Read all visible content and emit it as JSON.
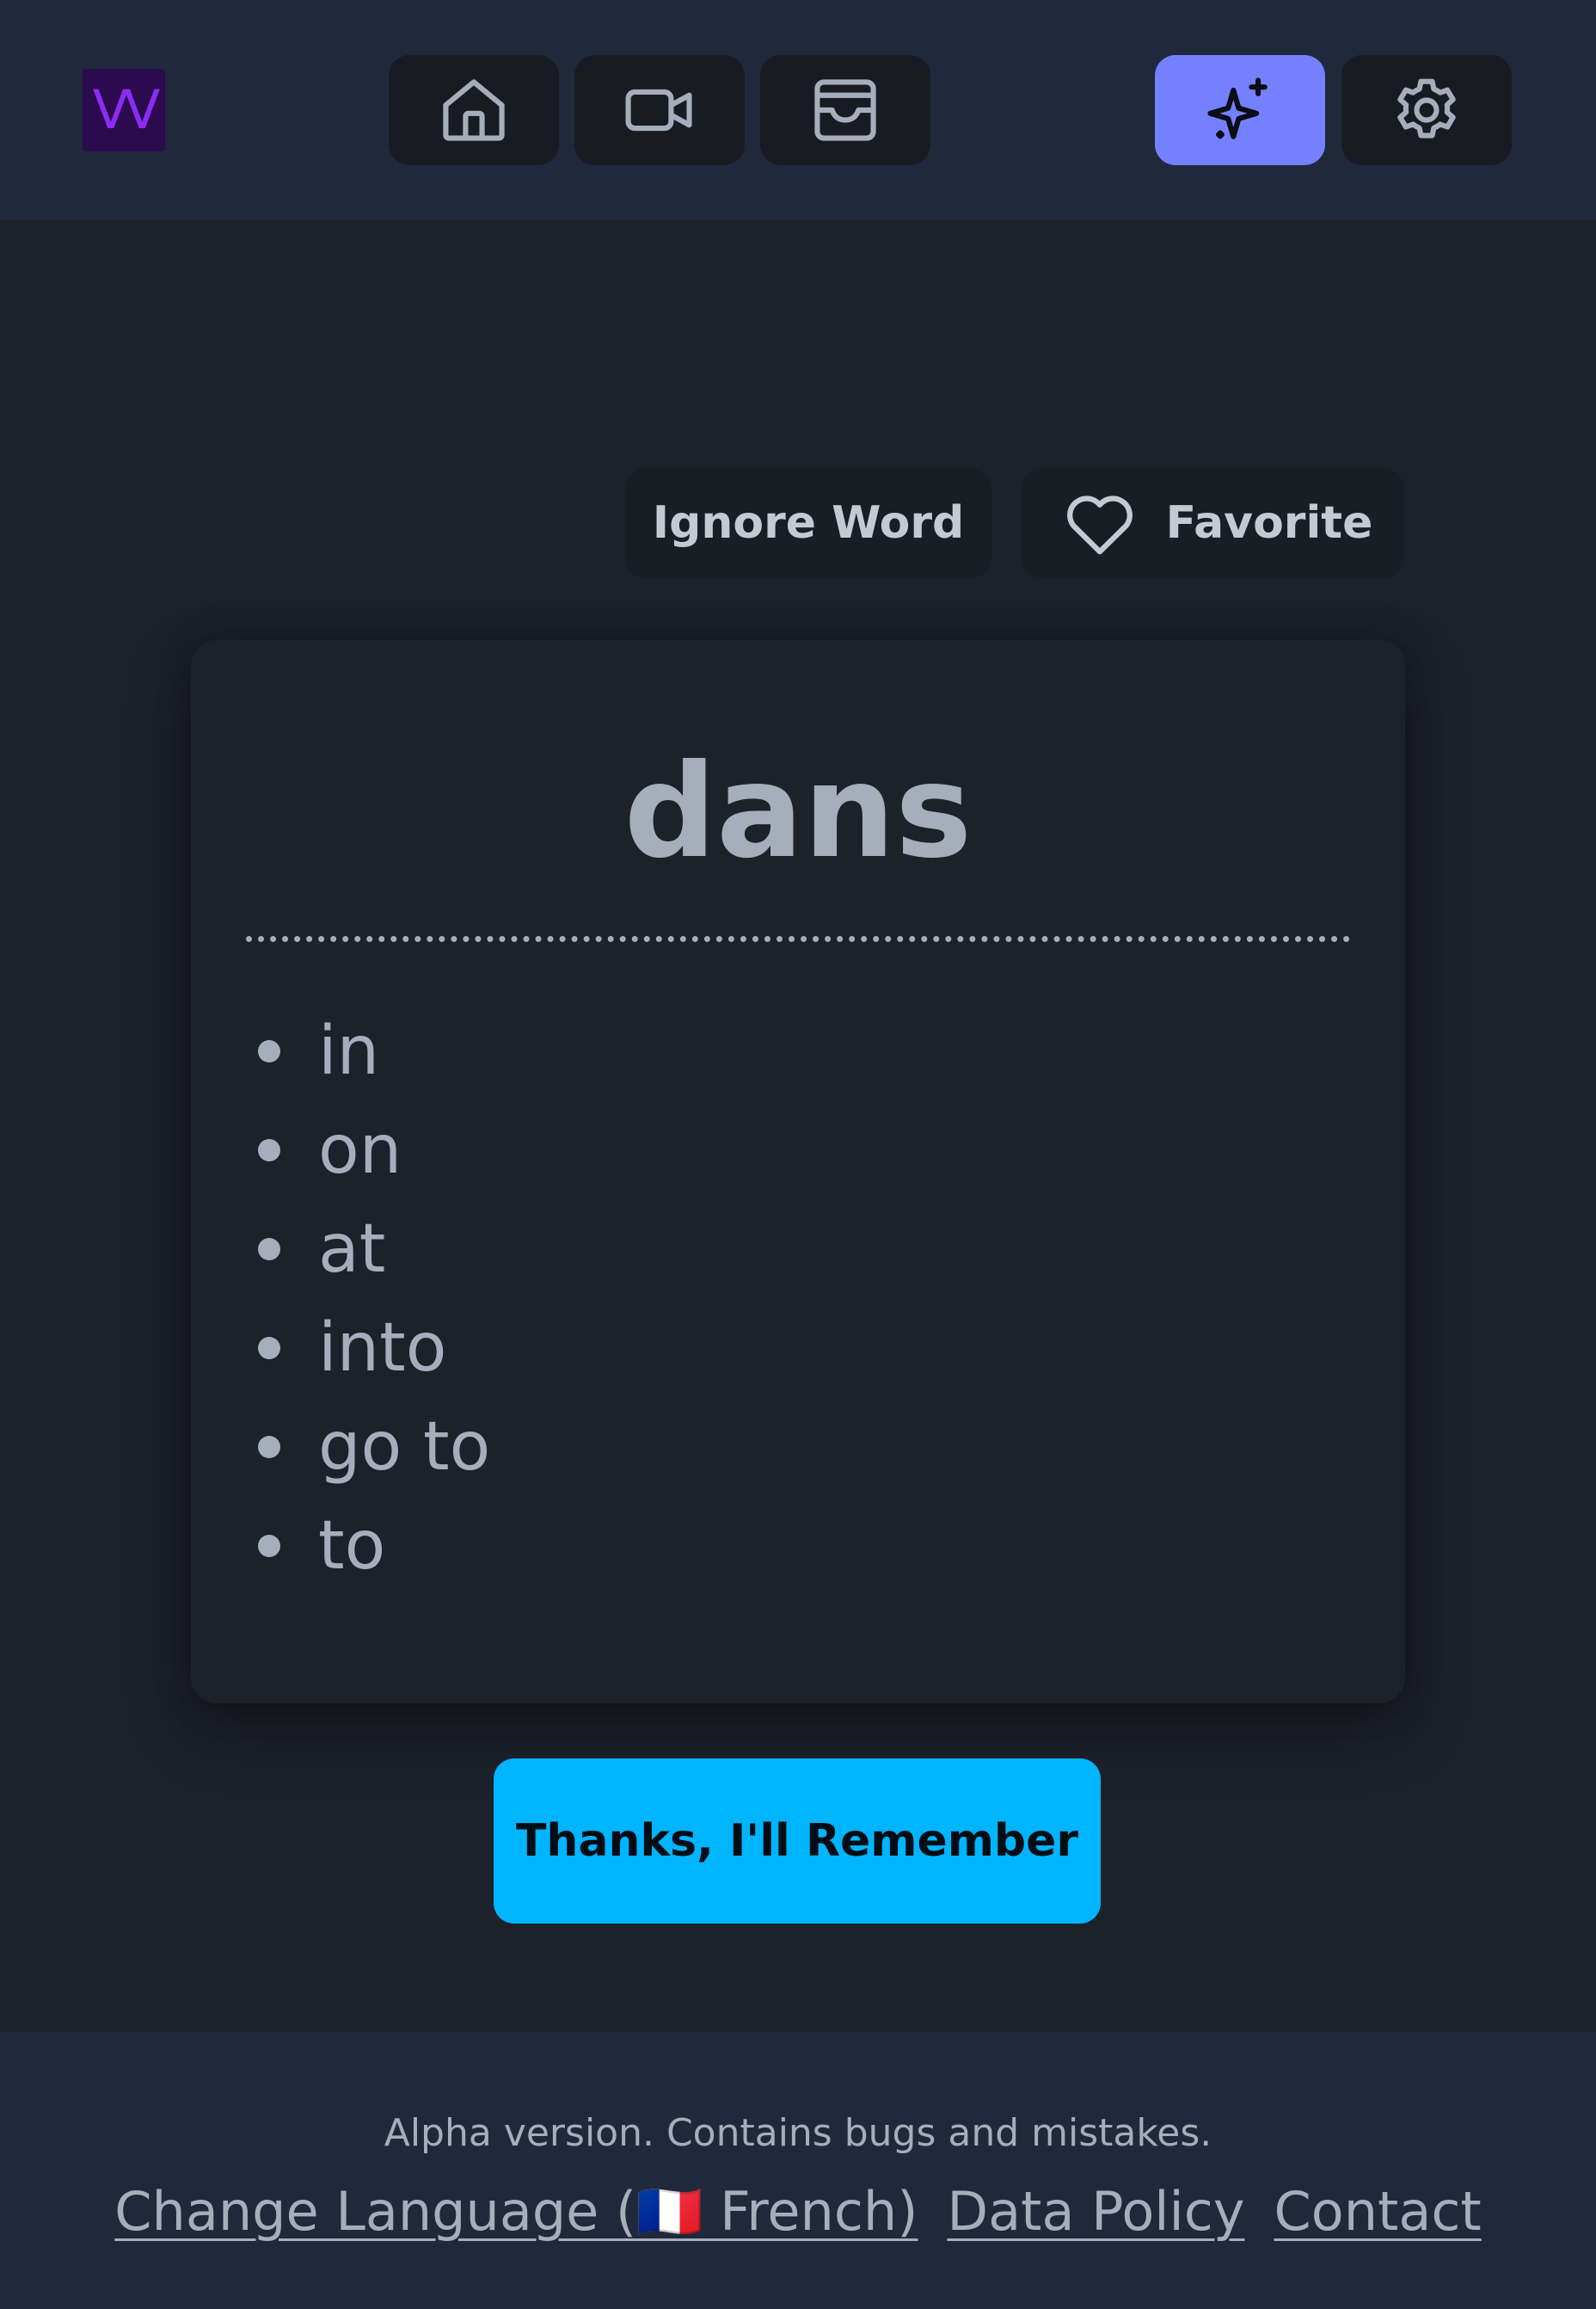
{
  "header": {
    "logo_text": "VV",
    "nav": [
      {
        "name": "home",
        "icon": "home-icon"
      },
      {
        "name": "video",
        "icon": "video-camera-icon"
      },
      {
        "name": "inbox",
        "icon": "inbox-icon"
      },
      {
        "name": "sparkle",
        "icon": "sparkles-icon",
        "active": true
      },
      {
        "name": "settings",
        "icon": "gear-icon"
      }
    ],
    "active_color": "#7480ff"
  },
  "actions": {
    "ignore_label": "Ignore Word",
    "favorite_label": "Favorite",
    "favorite_icon": "heart-icon"
  },
  "card": {
    "word": "dans",
    "translations": [
      "in",
      "on",
      "at",
      "into",
      "go to",
      "to"
    ]
  },
  "primary_button": {
    "label": "Thanks, I'll Remember",
    "color": "#00b5ff"
  },
  "footer": {
    "note": "Alpha version. Contains bugs and mistakes.",
    "change_language": "Change Language (🇫🇷 French)",
    "data_policy": "Data Policy",
    "contact": "Contact"
  }
}
